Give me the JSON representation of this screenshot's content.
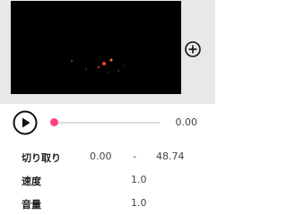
{
  "media": {
    "add_icon": "add-circle-icon",
    "video_colors": {
      "background": "#000000",
      "accent": "#ff4081"
    }
  },
  "playback": {
    "play_icon": "play-circle-icon",
    "current_time": "0.00",
    "progress_fraction": 0.0,
    "accent_color": "#ff4081"
  },
  "settings": {
    "trim": {
      "label": "切り取り",
      "start": "0.00",
      "separator": "-",
      "end": "48.74"
    },
    "speed": {
      "label": "速度",
      "value": "1.0"
    },
    "volume": {
      "label": "音量",
      "value": "1.0"
    }
  }
}
